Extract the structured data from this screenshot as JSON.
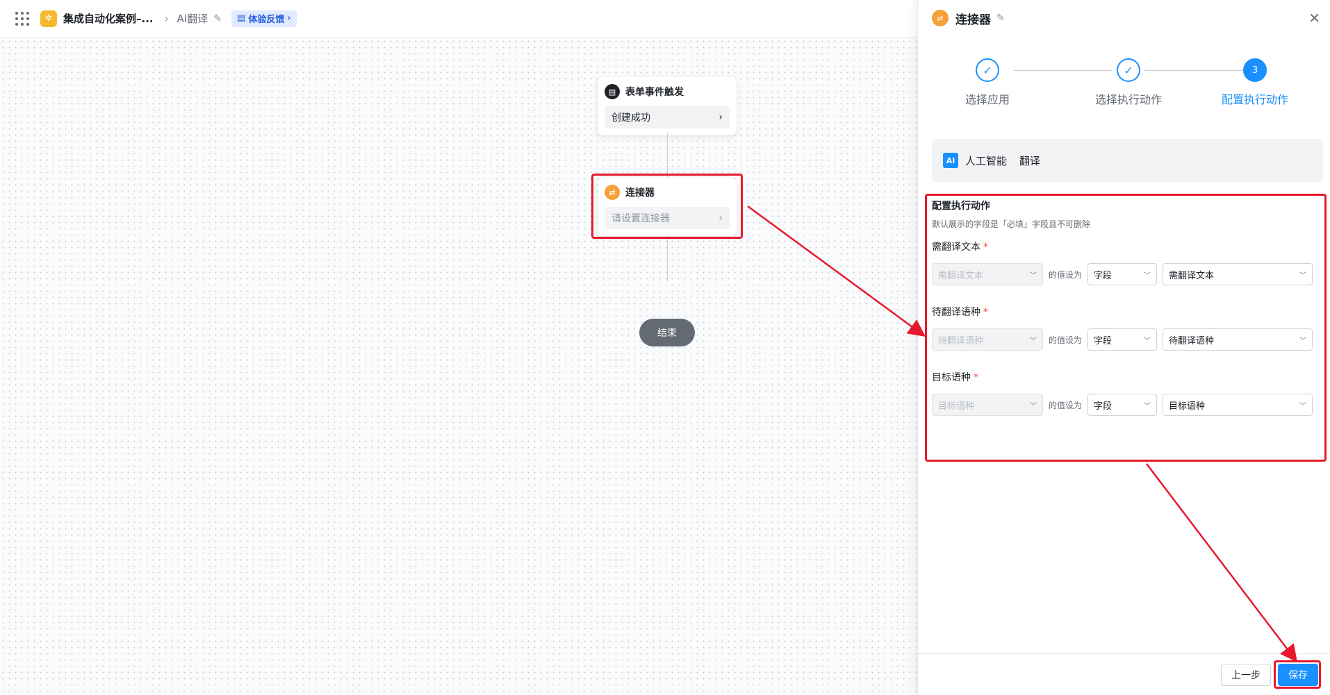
{
  "topbar": {
    "app_title": "集成自动化案例–...",
    "flow_name": "AI翻译",
    "feedback_label": "体验反馈"
  },
  "canvas": {
    "trigger": {
      "title": "表单事件触发",
      "value": "创建成功"
    },
    "connector": {
      "title": "连接器",
      "placeholder": "请设置连接器"
    },
    "end_label": "结束"
  },
  "panel": {
    "title": "连接器",
    "steps": [
      {
        "label": "选择应用",
        "state": "done"
      },
      {
        "label": "选择执行动作",
        "state": "done"
      },
      {
        "label": "配置执行动作",
        "state": "active",
        "number": "3"
      }
    ],
    "app": {
      "badge": "AI",
      "name": "人工智能",
      "action": "翻译"
    },
    "config": {
      "title": "配置执行动作",
      "desc": "默认展示的字段是「必填」字段且不可删除",
      "fields": [
        {
          "label": "需翻译文本",
          "field": "需翻译文本",
          "value_label": "的值设为",
          "type": "字段",
          "value": "需翻译文本"
        },
        {
          "label": "待翻译语种",
          "field": "待翻译语种",
          "value_label": "的值设为",
          "type": "字段",
          "value": "待翻译语种"
        },
        {
          "label": "目标语种",
          "field": "目标语种",
          "value_label": "的值设为",
          "type": "字段",
          "value": "目标语种"
        }
      ]
    },
    "footer": {
      "prev_label": "上一步",
      "save_label": "保存"
    }
  },
  "colors": {
    "accent": "#1890ff",
    "highlight": "#e8192c",
    "connector": "#f5a03a"
  }
}
